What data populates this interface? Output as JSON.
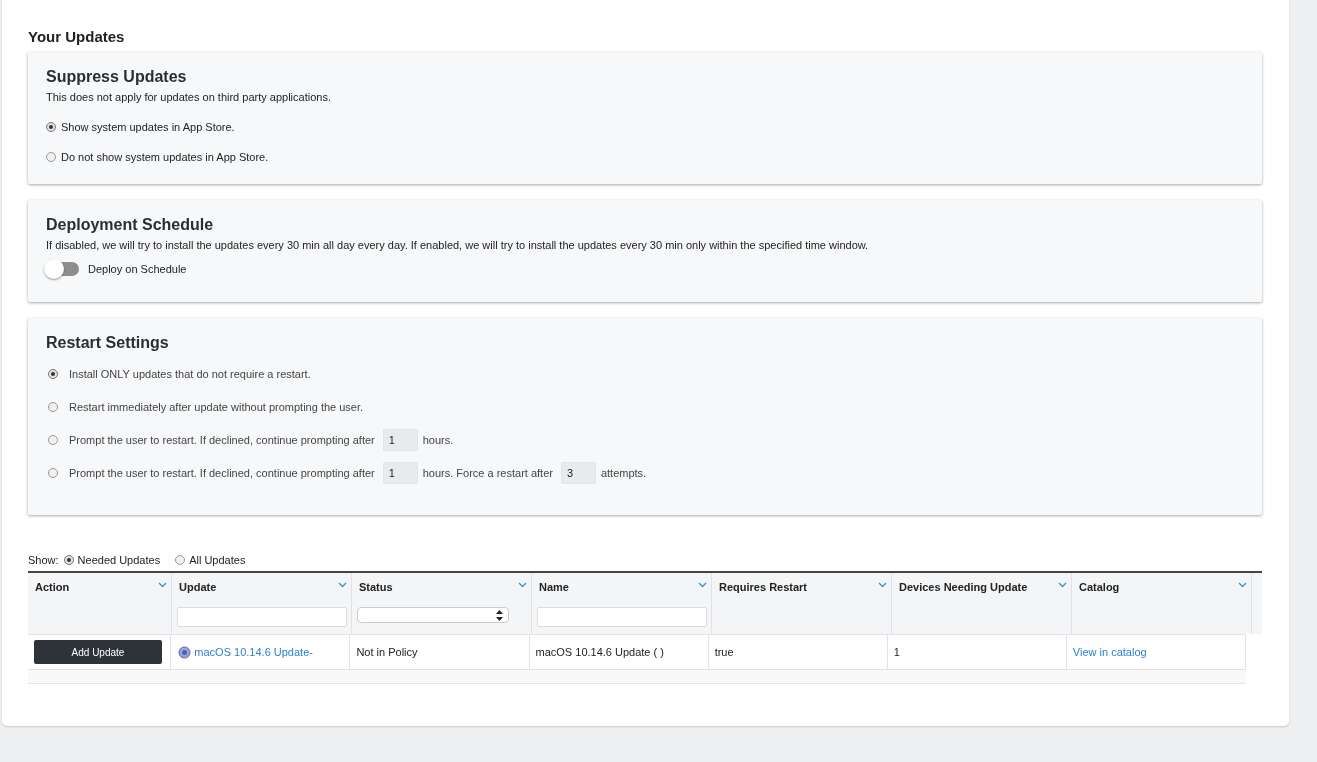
{
  "heading": "Your Updates",
  "suppress": {
    "title": "Suppress Updates",
    "description": "This does not apply for updates on third party applications.",
    "options": [
      {
        "label": "Show system updates in App Store.",
        "selected": true
      },
      {
        "label": "Do not show system updates in App Store.",
        "selected": false
      }
    ]
  },
  "schedule": {
    "title": "Deployment Schedule",
    "description": "If disabled, we will try to install the updates every 30 min all day every day. If enabled, we will try to install the updates every 30 min only within the specified time window.",
    "toggle": {
      "label": "Deploy on Schedule",
      "on": false
    }
  },
  "restart": {
    "title": "Restart Settings",
    "options": [
      {
        "selected": true,
        "parts": [
          {
            "kind": "text",
            "text": "Install ONLY updates that do not require a restart."
          }
        ]
      },
      {
        "selected": false,
        "parts": [
          {
            "kind": "text",
            "text": "Restart immediately after update without prompting the user."
          }
        ]
      },
      {
        "selected": false,
        "parts": [
          {
            "kind": "text",
            "text": "Prompt the user to restart. If declined, continue prompting after"
          },
          {
            "kind": "input",
            "value": "1"
          },
          {
            "kind": "text",
            "text": "hours."
          }
        ]
      },
      {
        "selected": false,
        "parts": [
          {
            "kind": "text",
            "text": "Prompt the user to restart. If declined, continue prompting after"
          },
          {
            "kind": "input",
            "value": "1"
          },
          {
            "kind": "text",
            "text": "hours. Force a restart after"
          },
          {
            "kind": "input",
            "value": "3"
          },
          {
            "kind": "text",
            "text": "attempts."
          }
        ]
      }
    ]
  },
  "show": {
    "label": "Show:",
    "options": [
      {
        "label": "Needed Updates",
        "selected": true
      },
      {
        "label": "All Updates",
        "selected": false
      }
    ]
  },
  "table": {
    "columns": [
      {
        "label": "Action",
        "kind": "plain"
      },
      {
        "label": "Update",
        "kind": "textfilter"
      },
      {
        "label": "Status",
        "kind": "selectfilter"
      },
      {
        "label": "Name",
        "kind": "textfilter"
      },
      {
        "label": "Requires Restart",
        "kind": "plain"
      },
      {
        "label": "Devices Needing Update",
        "kind": "plain"
      },
      {
        "label": "Catalog",
        "kind": "plain"
      }
    ],
    "rows": [
      {
        "cells": [
          {
            "kind": "button",
            "text": "Add Update"
          },
          {
            "kind": "icon-link",
            "text": "macOS 10.14.6 Update-"
          },
          {
            "kind": "text",
            "text": "Not in Policy"
          },
          {
            "kind": "text",
            "text": "macOS 10.14.6 Update ( )"
          },
          {
            "kind": "text",
            "text": "true"
          },
          {
            "kind": "text",
            "text": "1"
          },
          {
            "kind": "link",
            "text": "View in catalog"
          }
        ]
      }
    ]
  }
}
